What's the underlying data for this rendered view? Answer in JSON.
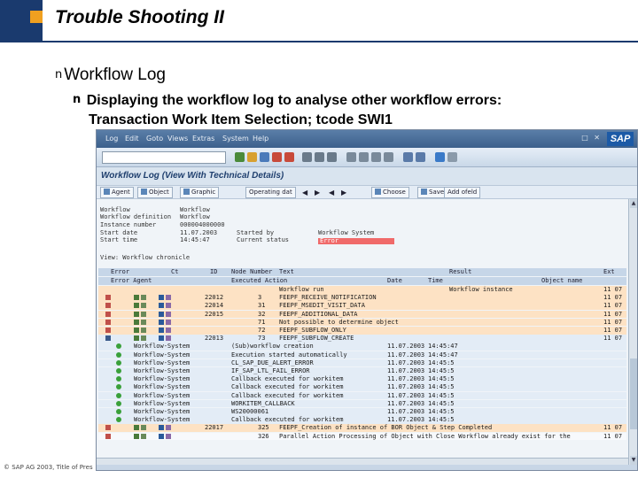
{
  "slide": {
    "title": "Trouble Shooting II",
    "bullet1": "Workflow Log",
    "bullet1_marker": "n",
    "bullet2_marker": "n",
    "bullet2_line1": "Displaying the workflow log to analyse other workflow errors:",
    "bullet2_line2": "Transaction Work Item Selection; tcode SWI1",
    "footer": "© SAP AG 2003, Title of Pres"
  },
  "sap_window": {
    "menu_items": [
      "Log",
      "Edit",
      "Goto",
      "Views",
      "Extras",
      "System",
      "Help"
    ],
    "window_controls": "□ ✕",
    "logo_text": "SAP",
    "screen_title": "Workflow Log (View With Technical Details)",
    "toolbar2_buttons": [
      "Agent",
      "Object",
      "Graphic",
      "Operating dat",
      "Choose",
      "Save",
      "Add ofeld"
    ],
    "toolbar2_arrows": [
      "◀",
      "▶",
      "◀",
      "▶"
    ],
    "colors": {
      "menubar": "#3c608c",
      "error_bar": "#f06a6a",
      "row_highlight": "#fde2c4",
      "table_header": "#c6d6e8",
      "accent_orange": "#f0a020",
      "header_blue": "#1a3a6e"
    },
    "header_fields": [
      {
        "label": "Workflow",
        "value": "Workflow"
      },
      {
        "label": "Workflow definition",
        "value": "Workflow"
      },
      {
        "label": "Instance number",
        "value": "000004000000"
      },
      {
        "label": "Start date",
        "value": "11.07.2003"
      },
      {
        "label": "Start time",
        "value": "14:45:47"
      }
    ],
    "right_fields": [
      {
        "label": "Started by",
        "value": "Workflow System"
      },
      {
        "label": "Current status",
        "value": "Error"
      }
    ],
    "view_label": "View: Workflow chronicle",
    "table_header1": [
      "Error",
      "Ct",
      "ID",
      "Node Number",
      "Text",
      "Result",
      "Ext"
    ],
    "table_header2": [
      "Error Agent",
      "Executed Action",
      "Date",
      "Time",
      "Object name"
    ],
    "rows": [
      {
        "type": "orange",
        "id": "",
        "node": "",
        "text": "Workflow run",
        "result": "Workflow instance",
        "ext": "11 07"
      },
      {
        "type": "orange",
        "id": "22012",
        "node": "3",
        "text": "FEEPF_RECEIVE_NOTIFICATION",
        "result": "",
        "ext": "11 07"
      },
      {
        "type": "orange",
        "id": "22014",
        "node": "31",
        "text": "FEEPF_MSEDIT_VISIT_DATA",
        "result": "",
        "ext": "11 07"
      },
      {
        "type": "orange",
        "id": "22015",
        "node": "32",
        "text": "FEEPF_ADDITIONAL_DATA",
        "result": "",
        "ext": "11 07"
      },
      {
        "type": "orange",
        "id": "",
        "node": "71",
        "text": "Not possible to determine object",
        "result": "",
        "ext": "11 07"
      },
      {
        "type": "orange",
        "id": "",
        "node": "72",
        "text": "FEEPF_SUBFLOW_ONLY",
        "result": "",
        "ext": "11 07"
      },
      {
        "type": "blue",
        "id": "22013",
        "node": "73",
        "text": "FEEPF_SUBFLOW_CREATE",
        "result": "",
        "ext": "11 07"
      }
    ],
    "sub_rows": [
      {
        "agent": "Workflow-System",
        "action": "(Sub)workflow creation",
        "date": "11.07.2003",
        "time": "14:45:47"
      },
      {
        "agent": "Workflow-System",
        "action": "Execution started automatically",
        "date": "11.07.2003",
        "time": "14:45:47"
      },
      {
        "agent": "Workflow-System",
        "action": "CL_SAP_DUE_ALERT_ERROR",
        "date": "11.07.2003",
        "time": "14:45:5"
      },
      {
        "agent": "Workflow-System",
        "action": "IF_SAP_LTL_FAIL_ERROR",
        "date": "11.07.2003",
        "time": "14:45:5"
      },
      {
        "agent": "Workflow-System",
        "action": "Callback executed for workitem",
        "date": "11.07.2003",
        "time": "14:45:5"
      },
      {
        "agent": "Workflow-System",
        "action": "Callback executed for workitem",
        "date": "11.07.2003",
        "time": "14:45:5"
      },
      {
        "agent": "Workflow-System",
        "action": "Callback executed for workitem",
        "date": "11.07.2003",
        "time": "14:45:5"
      },
      {
        "agent": "Workflow-System",
        "action": "WORKITEM_CALLBACK",
        "date": "11.07.2003",
        "time": "14:45:5"
      },
      {
        "agent": "Workflow-System",
        "action": "WS20000061",
        "date": "11.07.2003",
        "time": "14:45:5"
      },
      {
        "agent": "Workflow-System",
        "action": "Callback executed for workitem",
        "date": "11.07.2003",
        "time": "14:45:5"
      }
    ],
    "last_rows": [
      {
        "type": "orange",
        "id": "22017",
        "node": "325",
        "text": "FEEPF_Creation of instance of BOR Object & Step Completed",
        "ext": "11 07"
      },
      {
        "type": "white",
        "id": "",
        "node": "326",
        "text": "Parallel Action Processing of Object with Close Workflow already exist for the",
        "ext": "11 07"
      }
    ]
  }
}
